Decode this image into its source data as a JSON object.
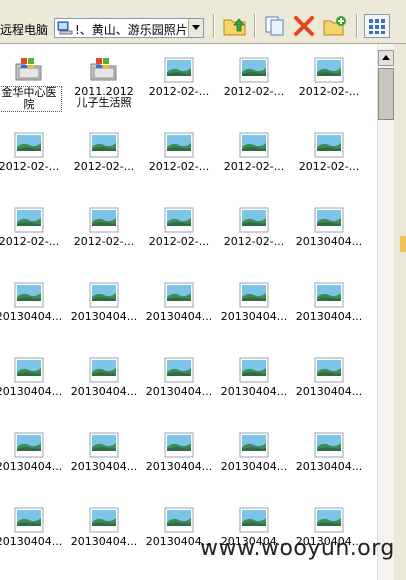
{
  "toolbar": {
    "location_label": "远程电脑",
    "path_text": "!、黄山、游乐园照片",
    "buttons": [
      "up-folder-icon",
      "copy-icon",
      "delete-icon",
      "new-folder-icon",
      "view-mode-icon"
    ]
  },
  "files": {
    "folders": [
      {
        "label": "金华中心医院"
      },
      {
        "label": "2011.2012儿子生活照"
      }
    ],
    "images": [
      "2012-02-...",
      "2012-02-...",
      "2012-02-...",
      "2012-02-...",
      "2012-02-...",
      "2012-02-...",
      "2012-02-...",
      "2012-02-...",
      "2012-02-...",
      "2012-02-...",
      "2012-02-...",
      "2012-02-...",
      "20130404...",
      "20130404...",
      "20130404...",
      "20130404...",
      "20130404...",
      "20130404...",
      "20130404...",
      "20130404...",
      "20130404...",
      "20130404...",
      "20130404...",
      "20130404...",
      "20130404...",
      "20130404...",
      "20130404...",
      "20130404...",
      "20130404...",
      "20130404...",
      "20130404...",
      "20130404...",
      "20130404..."
    ]
  },
  "watermark": "www.wooyun.org",
  "colors": {
    "toolbar_bg": "#ece9d8",
    "accent": "#7f9db9"
  }
}
